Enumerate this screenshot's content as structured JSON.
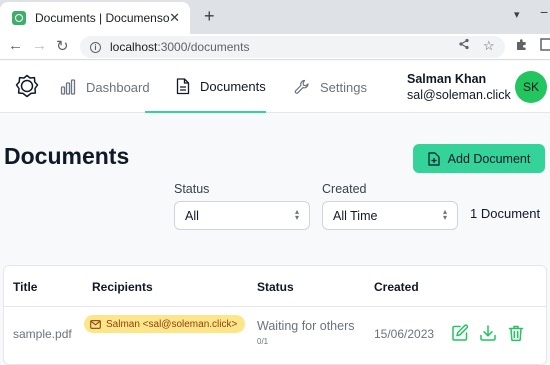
{
  "browser": {
    "tab_title": "Documents | Documenso",
    "url_host": "localhost",
    "url_rest": ":3000/documents"
  },
  "nav": {
    "items": [
      {
        "label": "Dashboard",
        "active": false
      },
      {
        "label": "Documents",
        "active": true
      },
      {
        "label": "Settings",
        "active": false
      }
    ]
  },
  "user": {
    "name": "Salman Khan",
    "email": "sal@soleman.click",
    "initials": "SK"
  },
  "main": {
    "title": "Documents",
    "add_button": "Add Document",
    "filters": {
      "status_label": "Status",
      "status_value": "All",
      "created_label": "Created",
      "created_value": "All Time"
    },
    "doc_count": "1 Document"
  },
  "table": {
    "headers": [
      "Title",
      "Recipients",
      "Status",
      "Created"
    ],
    "rows": [
      {
        "title": "sample.pdf",
        "recipient": "Salman <sal@soleman.click>",
        "status": "Waiting for others",
        "status_sub": "0/1",
        "created": "15/06/2023"
      }
    ]
  },
  "colors": {
    "accent": "#34d399",
    "avatar": "#22c55e",
    "pill_bg": "#fde68a",
    "pill_text": "#92400e"
  }
}
